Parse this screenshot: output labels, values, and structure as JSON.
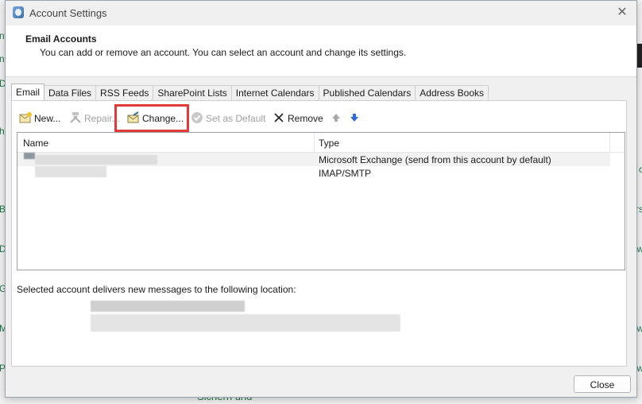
{
  "window": {
    "title": "Account Settings",
    "close_glyph": "✕"
  },
  "header": {
    "title": "Email Accounts",
    "subtitle": "You can add or remove an account. You can select an account and change its settings."
  },
  "tabs": [
    {
      "label": "Email",
      "active": true
    },
    {
      "label": "Data Files"
    },
    {
      "label": "RSS Feeds"
    },
    {
      "label": "SharePoint Lists"
    },
    {
      "label": "Internet Calendars"
    },
    {
      "label": "Published Calendars"
    },
    {
      "label": "Address Books"
    }
  ],
  "toolbar": {
    "new_label": "New...",
    "repair_label": "Repair...",
    "change_label": "Change...",
    "set_default_label": "Set as Default",
    "remove_label": "Remove"
  },
  "list": {
    "columns": {
      "name": "Name",
      "type": "Type"
    },
    "rows": [
      {
        "type": "Microsoft Exchange (send from this account by default)"
      },
      {
        "type": "IMAP/SMTP"
      }
    ]
  },
  "delivery": {
    "label": "Selected account delivers new messages to the following location:"
  },
  "footer": {
    "close_label": "Close"
  },
  "background": {
    "bottom_text": "Sichern und",
    "left_letters": [
      "n",
      "n",
      "D",
      "h",
      "B",
      "D",
      "G",
      "M",
      "P"
    ],
    "right_letters": [
      "c",
      "rs",
      "w",
      "w",
      "w",
      "s"
    ]
  },
  "colors": {
    "highlight": "#e03a3a",
    "background_app_text": "#1f7a4a"
  },
  "icons": {
    "app": "outlook-icon",
    "close": "close-icon",
    "new": "new-account-icon",
    "repair": "repair-tools-icon",
    "change": "change-account-icon",
    "set_default": "checkmark-icon",
    "remove": "remove-x-icon",
    "up": "arrow-up-icon",
    "down": "arrow-down-icon"
  }
}
